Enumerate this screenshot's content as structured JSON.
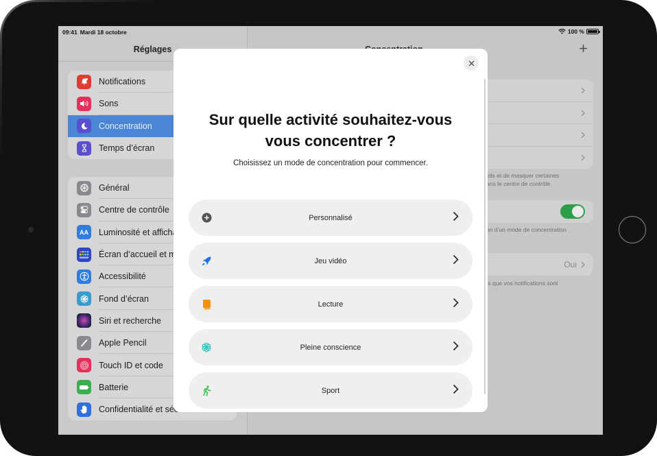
{
  "status_bar": {
    "time": "09:41",
    "date": "Mardi 18 octobre",
    "battery_text": "100 %",
    "battery_level": 1.0
  },
  "sidebar": {
    "title": "Réglages",
    "groups": [
      {
        "items": [
          {
            "label": "Notifications",
            "icon": "bell-icon",
            "color": "#e23b32"
          },
          {
            "label": "Sons",
            "icon": "speaker-icon",
            "color": "#e5305b"
          },
          {
            "label": "Concentration",
            "icon": "moon-icon",
            "color": "#5b4fd1",
            "selected": true
          },
          {
            "label": "Temps d’écran",
            "icon": "hourglass-icon",
            "color": "#5b4fd1"
          }
        ]
      },
      {
        "items": [
          {
            "label": "Général",
            "icon": "gear-icon",
            "color": "#8a8a8e"
          },
          {
            "label": "Centre de contrôle",
            "icon": "toggles-icon",
            "color": "#8a8a8e"
          },
          {
            "label": "Luminosité et affichage",
            "icon": "text-size-icon",
            "color": "#2f7de1"
          },
          {
            "label": "Écran d’accueil et multitâche",
            "icon": "app-grid-icon",
            "color": "#2b46c9"
          },
          {
            "label": "Accessibilité",
            "icon": "accessibility-icon",
            "color": "#2f7de1"
          },
          {
            "label": "Fond d’écran",
            "icon": "flower-icon",
            "color": "#3a9bd0"
          },
          {
            "label": "Siri et recherche",
            "icon": "siri-icon",
            "color": "#222"
          },
          {
            "label": "Apple Pencil",
            "icon": "pencil-icon",
            "color": "#8a8a8e"
          },
          {
            "label": "Touch ID et code",
            "icon": "fingerprint-icon",
            "color": "#e5305b"
          },
          {
            "label": "Batterie",
            "icon": "battery-icon",
            "color": "#3bae4f"
          },
          {
            "label": "Confidentialité et sécurité",
            "icon": "hand-icon",
            "color": "#2f6fe0"
          }
        ]
      }
    ]
  },
  "detail": {
    "title": "Concentration",
    "add_label": "+",
    "note_1": "eils et de masquer certaines\nans le centre de contrôle.",
    "note_2": "on d’un mode de concentration",
    "share_value": "Oui",
    "note_3": "ts que vos notifications sont",
    "toggle_on": true
  },
  "modal": {
    "title_line1": "Sur quelle activité souhaitez-vous",
    "title_line2": "vous concentrer ?",
    "subtitle": "Choisissez un mode de concentration pour commencer.",
    "close_label": "×",
    "options": [
      {
        "label": "Personnalisé",
        "icon": "plus-circle-icon",
        "color": "#555555"
      },
      {
        "label": "Jeu vidéo",
        "icon": "rocket-icon",
        "color": "#1d6ff2"
      },
      {
        "label": "Lecture",
        "icon": "book-icon",
        "color": "#f5900c"
      },
      {
        "label": "Pleine conscience",
        "icon": "mindfulness-flower-icon",
        "color": "#2fc2c0"
      },
      {
        "label": "Sport",
        "icon": "running-figure-icon",
        "color": "#36c24a"
      }
    ]
  }
}
